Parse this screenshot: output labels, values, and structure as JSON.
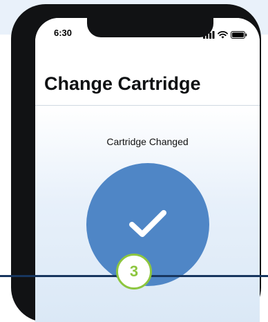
{
  "status_bar": {
    "time": "6:30",
    "icons": [
      "signal-icon",
      "wifi-icon",
      "battery-icon"
    ]
  },
  "header": {
    "title": "Change Cartridge"
  },
  "main": {
    "status_text": "Cartridge Changed",
    "success_icon": "checkmark-icon"
  },
  "step_badge": {
    "number": "3"
  },
  "colors": {
    "accent_blue": "#4f86c6",
    "step_green": "#8dc63f",
    "navy_line": "#17365f",
    "phone_frame": "#111214"
  }
}
